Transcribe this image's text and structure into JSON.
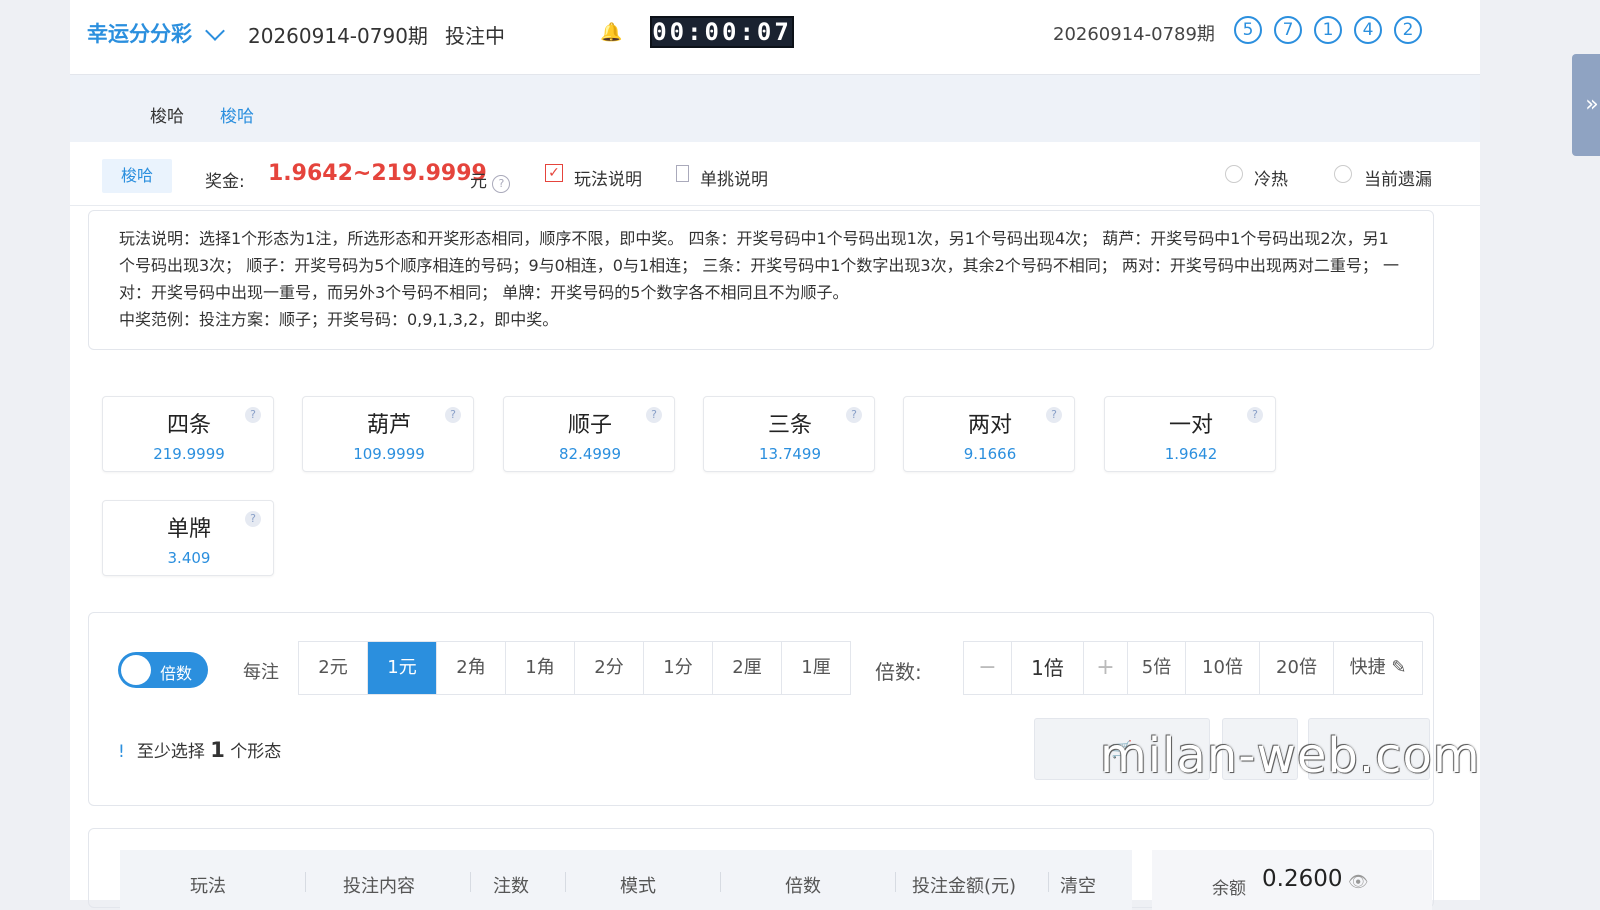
{
  "header": {
    "lottery_name": "幸运分分彩",
    "current_issue": "20260914-0790期",
    "status": "投注中",
    "timer": "00:00:07",
    "prev_issue": "20260914-0789期",
    "balls": [
      "5",
      "7",
      "1",
      "4",
      "2"
    ]
  },
  "subnav": {
    "tabs": [
      "梭哈",
      "梭哈"
    ],
    "active": 1
  },
  "rule_bar": {
    "pill": "梭哈",
    "prize_label": "奖金:",
    "prize_value": "1.9642~219.9999",
    "prize_unit": "元",
    "help_glyph": "?",
    "check_glyph": "✓",
    "rules_label": "玩法说明",
    "solo_label": "单挑说明",
    "hotcold_label": "冷热",
    "missing_label": "当前遗漏"
  },
  "description": {
    "text": "玩法说明：选择1个形态为1注，所选形态和开奖形态相同，顺序不限，即中奖。 四条：开奖号码中1个号码出现1次，另1个号码出现4次； 葫芦：开奖号码中1个号码出现2次，另1个号码出现3次； 顺子：开奖号码为5个顺序相连的号码；9与0相连，0与1相连； 三条：开奖号码中1个数字出现3次，其余2个号码不相同； 两对：开奖号码中出现两对二重号； 一对：开奖号码中出现一重号，而另外3个号码不相同； 单牌：开奖号码的5个数字各不相同且不为顺子。",
    "example": "中奖范例：投注方案：顺子；开奖号码：0,9,1,3,2，即中奖。"
  },
  "options": [
    {
      "name": "四条",
      "odds": "219.9999"
    },
    {
      "name": "葫芦",
      "odds": "109.9999"
    },
    {
      "name": "顺子",
      "odds": "82.4999"
    },
    {
      "name": "三条",
      "odds": "13.7499"
    },
    {
      "name": "两对",
      "odds": "9.1666"
    },
    {
      "name": "一对",
      "odds": "1.9642"
    },
    {
      "name": "单牌",
      "odds": "3.409"
    }
  ],
  "bet": {
    "toggle_label": "倍数",
    "per_bet_label": "每注",
    "units": [
      "2元",
      "1元",
      "2角",
      "1角",
      "2分",
      "1分",
      "2厘",
      "1厘"
    ],
    "active_unit": 1,
    "multiplier_label": "倍数:",
    "minus": "−",
    "plus": "+",
    "multiplier_value": "1倍",
    "multiplier_presets": [
      "5倍",
      "10倍",
      "20倍"
    ],
    "quick_label": "快捷",
    "hint_pre": "至少选择",
    "hint_num": "1",
    "hint_post": "个形态",
    "hint_icon": "!",
    "cart_icon": "🛒",
    "edit_icon": "✎"
  },
  "table": {
    "headers": [
      "玩法",
      "投注内容",
      "注数",
      "模式",
      "倍数",
      "投注金额(元)",
      "清空"
    ],
    "balance_label": "余额",
    "balance_value": "0.2600",
    "eye_icon": "👁"
  },
  "drawer_icon": "»",
  "watermark": "milan-web.com"
}
